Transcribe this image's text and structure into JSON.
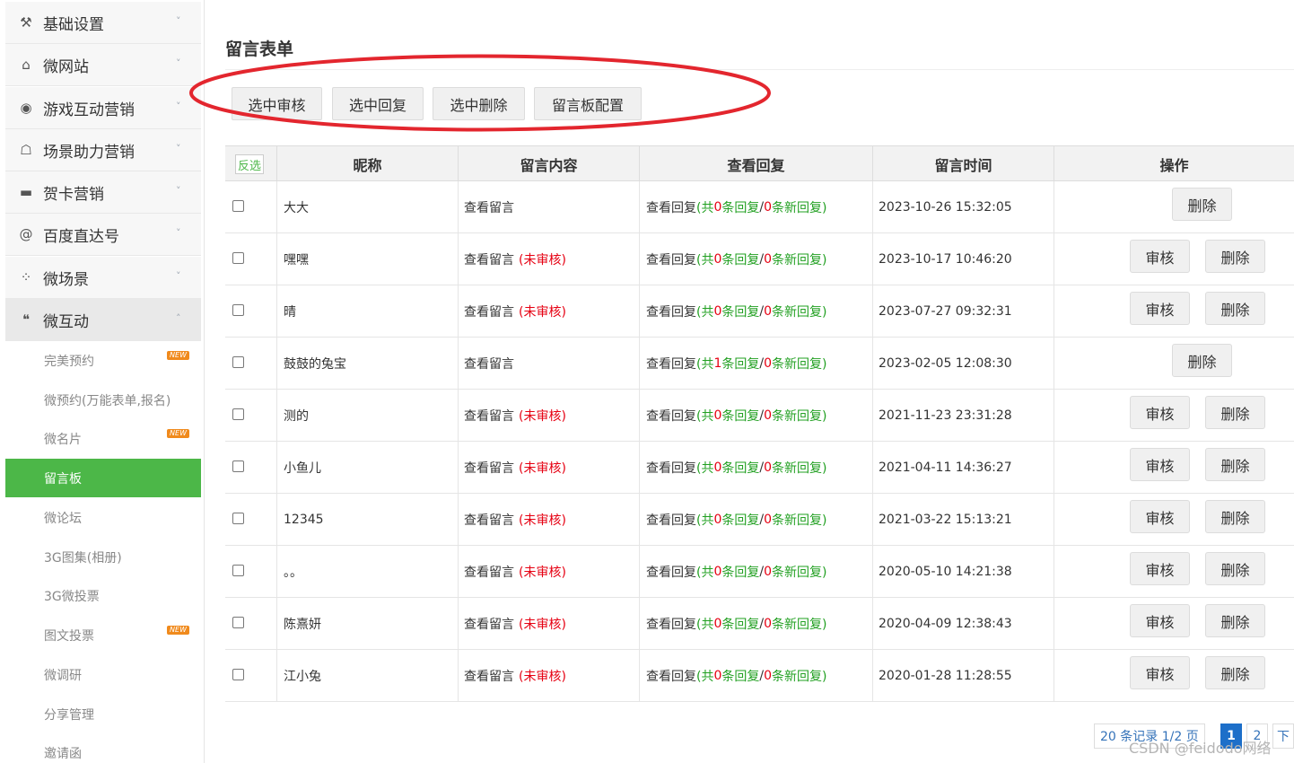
{
  "sidebar": {
    "menus": [
      {
        "label": "基础设置",
        "icon": "tools-icon"
      },
      {
        "label": "微网站",
        "icon": "home-icon"
      },
      {
        "label": "游戏互动营销",
        "icon": "gamepad-icon"
      },
      {
        "label": "场景助力营销",
        "icon": "bank-icon"
      },
      {
        "label": "贺卡营销",
        "icon": "card-icon"
      },
      {
        "label": "百度直达号",
        "icon": "at-icon"
      },
      {
        "label": "微场景",
        "icon": "dots-icon"
      },
      {
        "label": "微互动",
        "icon": "chat-icon"
      }
    ],
    "sub_items": [
      {
        "label": "完美预约",
        "badge": "NEW"
      },
      {
        "label": "微预约(万能表单,报名)",
        "badge": ""
      },
      {
        "label": "微名片",
        "badge": "NEW"
      },
      {
        "label": "留言板",
        "badge": ""
      },
      {
        "label": "微论坛",
        "badge": ""
      },
      {
        "label": "3G图集(相册)",
        "badge": ""
      },
      {
        "label": "3G微投票",
        "badge": ""
      },
      {
        "label": "图文投票",
        "badge": "NEW"
      },
      {
        "label": "微调研",
        "badge": ""
      },
      {
        "label": "分享管理",
        "badge": ""
      },
      {
        "label": "邀请函",
        "badge": ""
      }
    ],
    "active_sub": "留言板"
  },
  "page": {
    "title": "留言表单"
  },
  "toolbar": {
    "buttons": [
      "选中审核",
      "选中回复",
      "选中删除",
      "留言板配置"
    ]
  },
  "table": {
    "invert_label": "反选",
    "headers": [
      "昵称",
      "留言内容",
      "查看回复",
      "留言时间",
      "操作"
    ],
    "view_message": "查看留言",
    "unreviewed": "(未审核)",
    "view_reply": "查看回复",
    "approve_label": "审核",
    "delete_label": "删除",
    "rows": [
      {
        "nickname": "大大",
        "unreviewed": false,
        "reply_total": "0",
        "reply_new": "0",
        "time": "2023-10-26 15:32:05"
      },
      {
        "nickname": "嘿嘿",
        "unreviewed": true,
        "reply_total": "0",
        "reply_new": "0",
        "time": "2023-10-17 10:46:20"
      },
      {
        "nickname": "晴",
        "unreviewed": true,
        "reply_total": "0",
        "reply_new": "0",
        "time": "2023-07-27 09:32:31"
      },
      {
        "nickname": "鼓鼓的兔宝",
        "unreviewed": false,
        "reply_total": "1",
        "reply_new": "0",
        "time": "2023-02-05 12:08:30"
      },
      {
        "nickname": "测的",
        "unreviewed": true,
        "reply_total": "0",
        "reply_new": "0",
        "time": "2021-11-23 23:31:28"
      },
      {
        "nickname": "小鱼儿",
        "unreviewed": true,
        "reply_total": "0",
        "reply_new": "0",
        "time": "2021-04-11 14:36:27"
      },
      {
        "nickname": "12345",
        "unreviewed": true,
        "reply_total": "0",
        "reply_new": "0",
        "time": "2021-03-22 15:13:21"
      },
      {
        "nickname": "。。",
        "unreviewed": true,
        "reply_total": "0",
        "reply_new": "0",
        "time": "2020-05-10 14:21:38"
      },
      {
        "nickname": "陈熹妍",
        "unreviewed": true,
        "reply_total": "0",
        "reply_new": "0",
        "time": "2020-04-09 12:38:43"
      },
      {
        "nickname": "江小兔",
        "unreviewed": true,
        "reply_total": "0",
        "reply_new": "0",
        "time": "2020-01-28 11:28:55"
      }
    ]
  },
  "pagination": {
    "info": "20 条记录 1/2 页",
    "pages": [
      "1",
      "2"
    ],
    "next": "下",
    "current": "1"
  },
  "watermark": "CSDN @feidodo网络",
  "colors": {
    "accent_green": "#4cb748",
    "annotation_red": "#e3262e",
    "warn_red": "#e60012",
    "count_green": "#22a022"
  }
}
